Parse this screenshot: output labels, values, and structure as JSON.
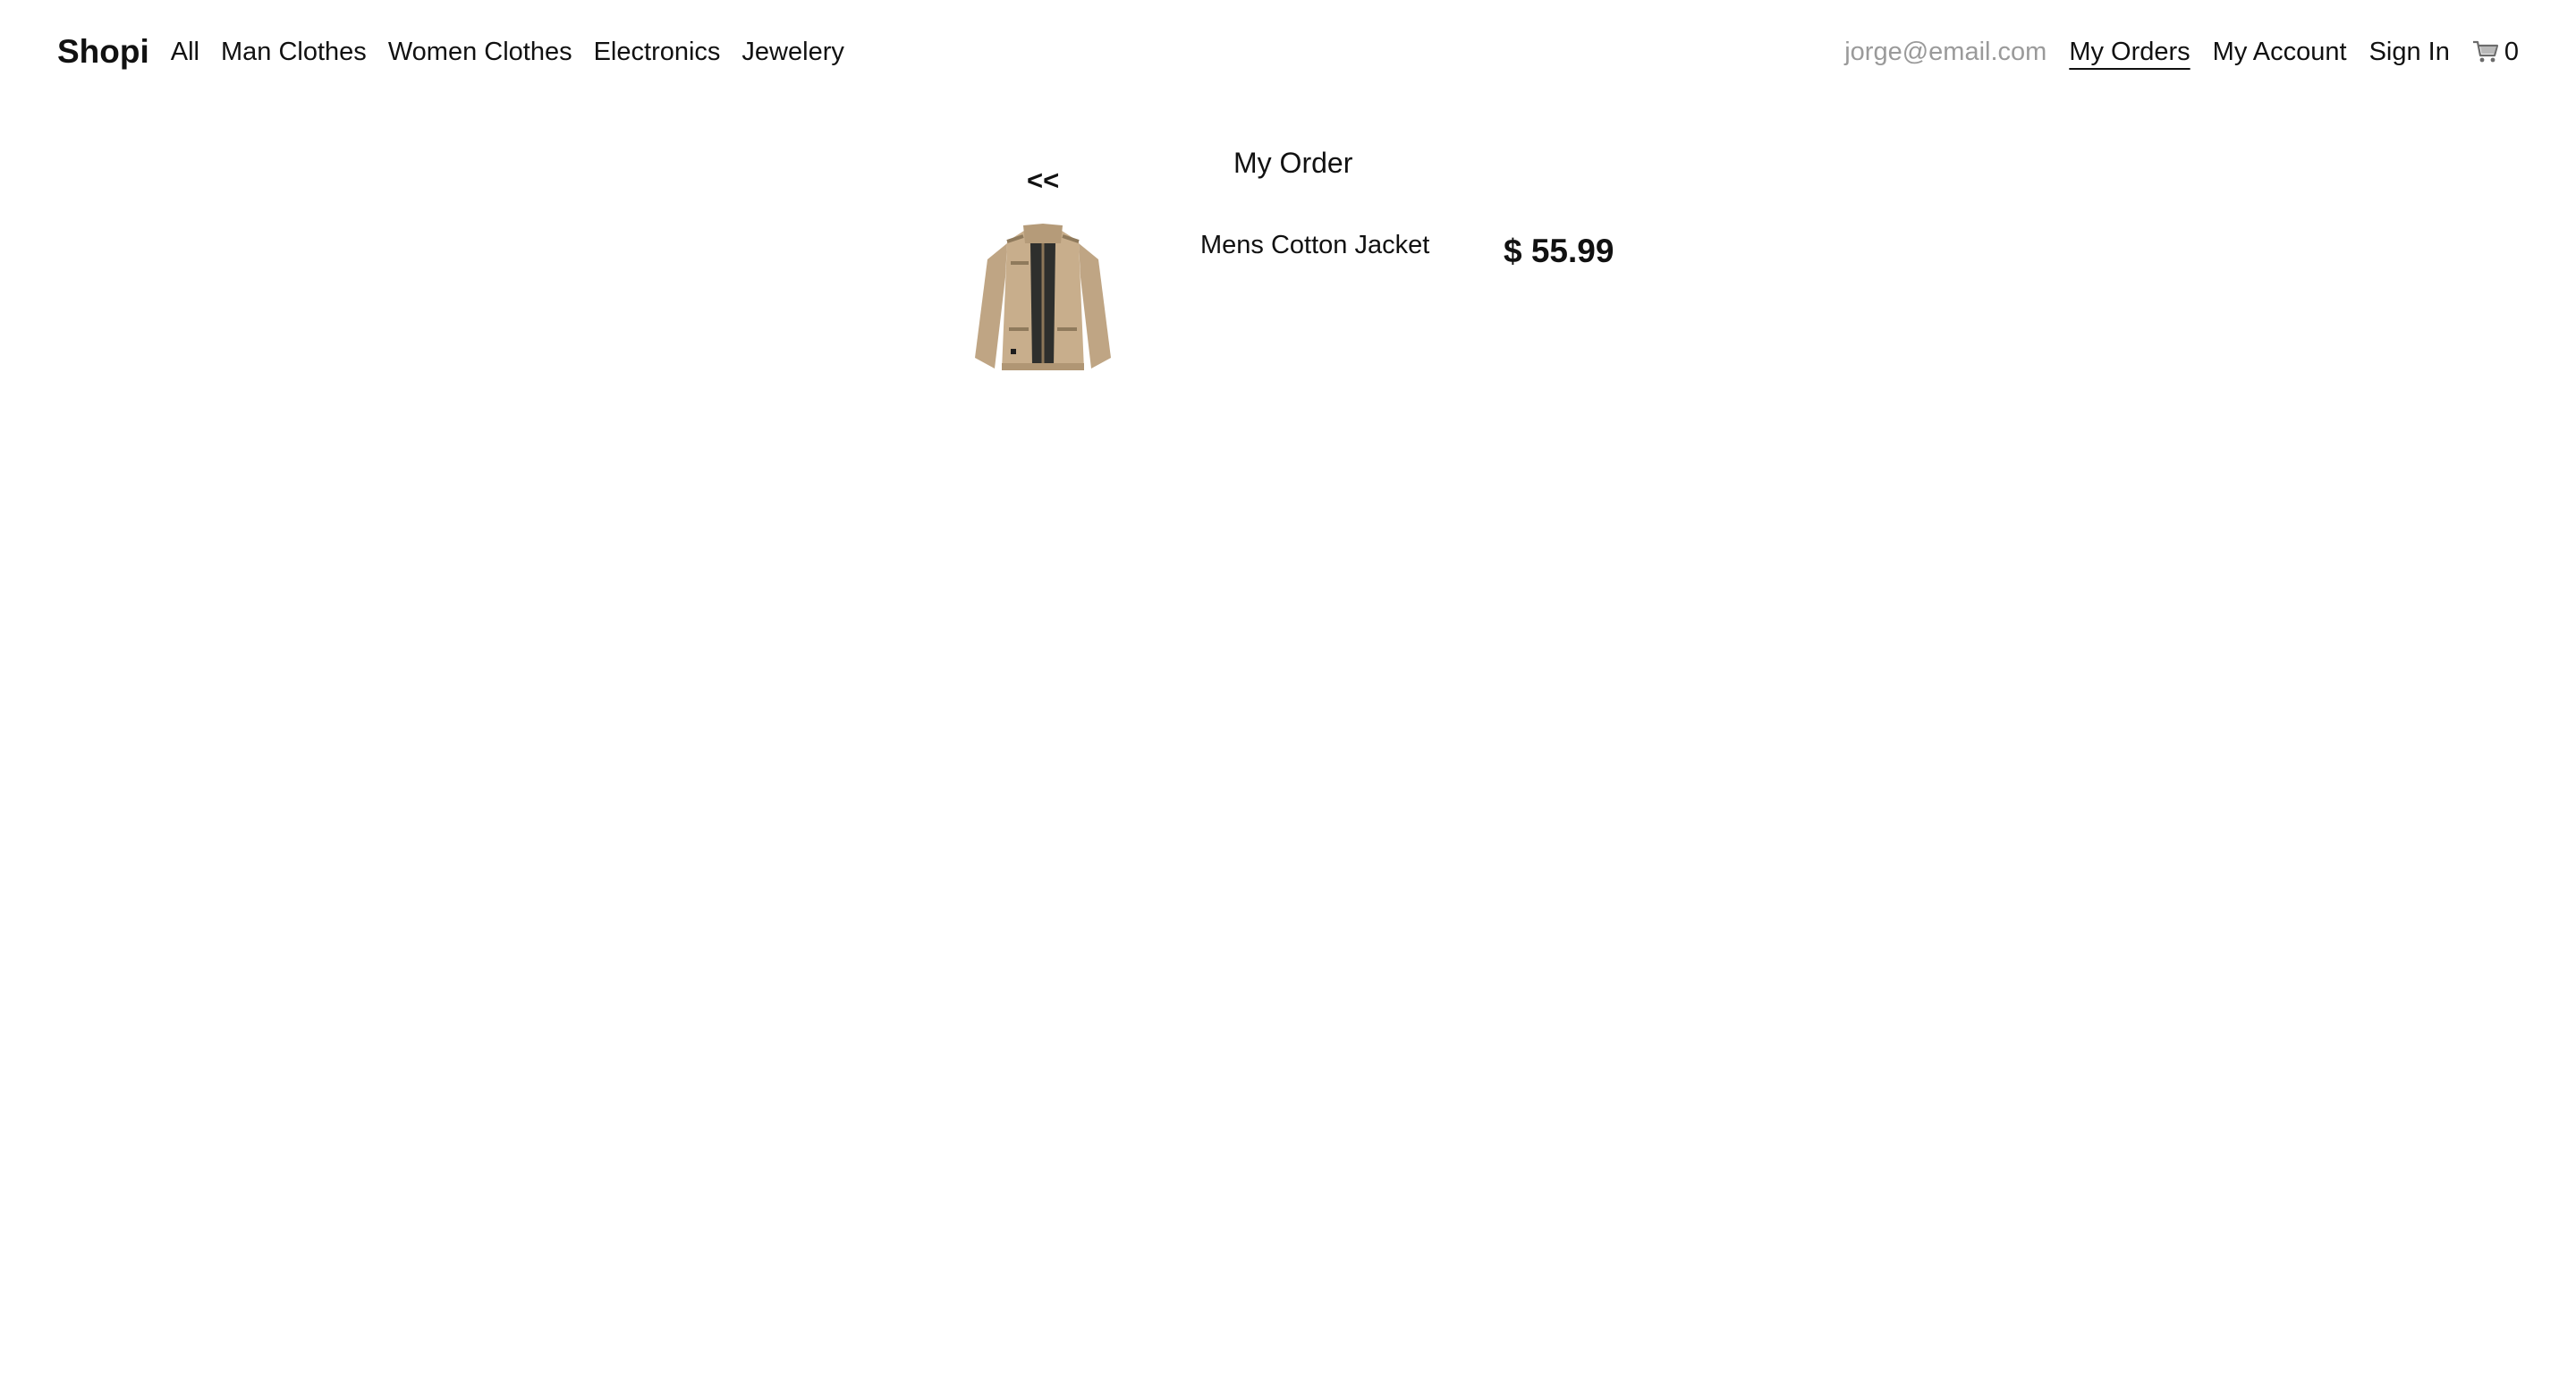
{
  "navbar": {
    "brand": "Shopi",
    "categories": [
      "All",
      "Man Clothes",
      "Women Clothes",
      "Electronics",
      "Jewelery"
    ],
    "email": "jorge@email.com",
    "my_orders": "My Orders",
    "my_account": "My Account",
    "sign_in": "Sign In",
    "cart_icon": "cart-icon",
    "cart_count": "0"
  },
  "order": {
    "back_label": "<<",
    "title": "My Order",
    "items": [
      {
        "image_icon": "jacket-image",
        "name": "Mens Cotton Jacket",
        "price": "$ 55.99"
      }
    ]
  },
  "colors": {
    "text": "#111111",
    "muted": "#9a9a9a",
    "background": "#ffffff",
    "jacket": "#c4ab8a"
  }
}
